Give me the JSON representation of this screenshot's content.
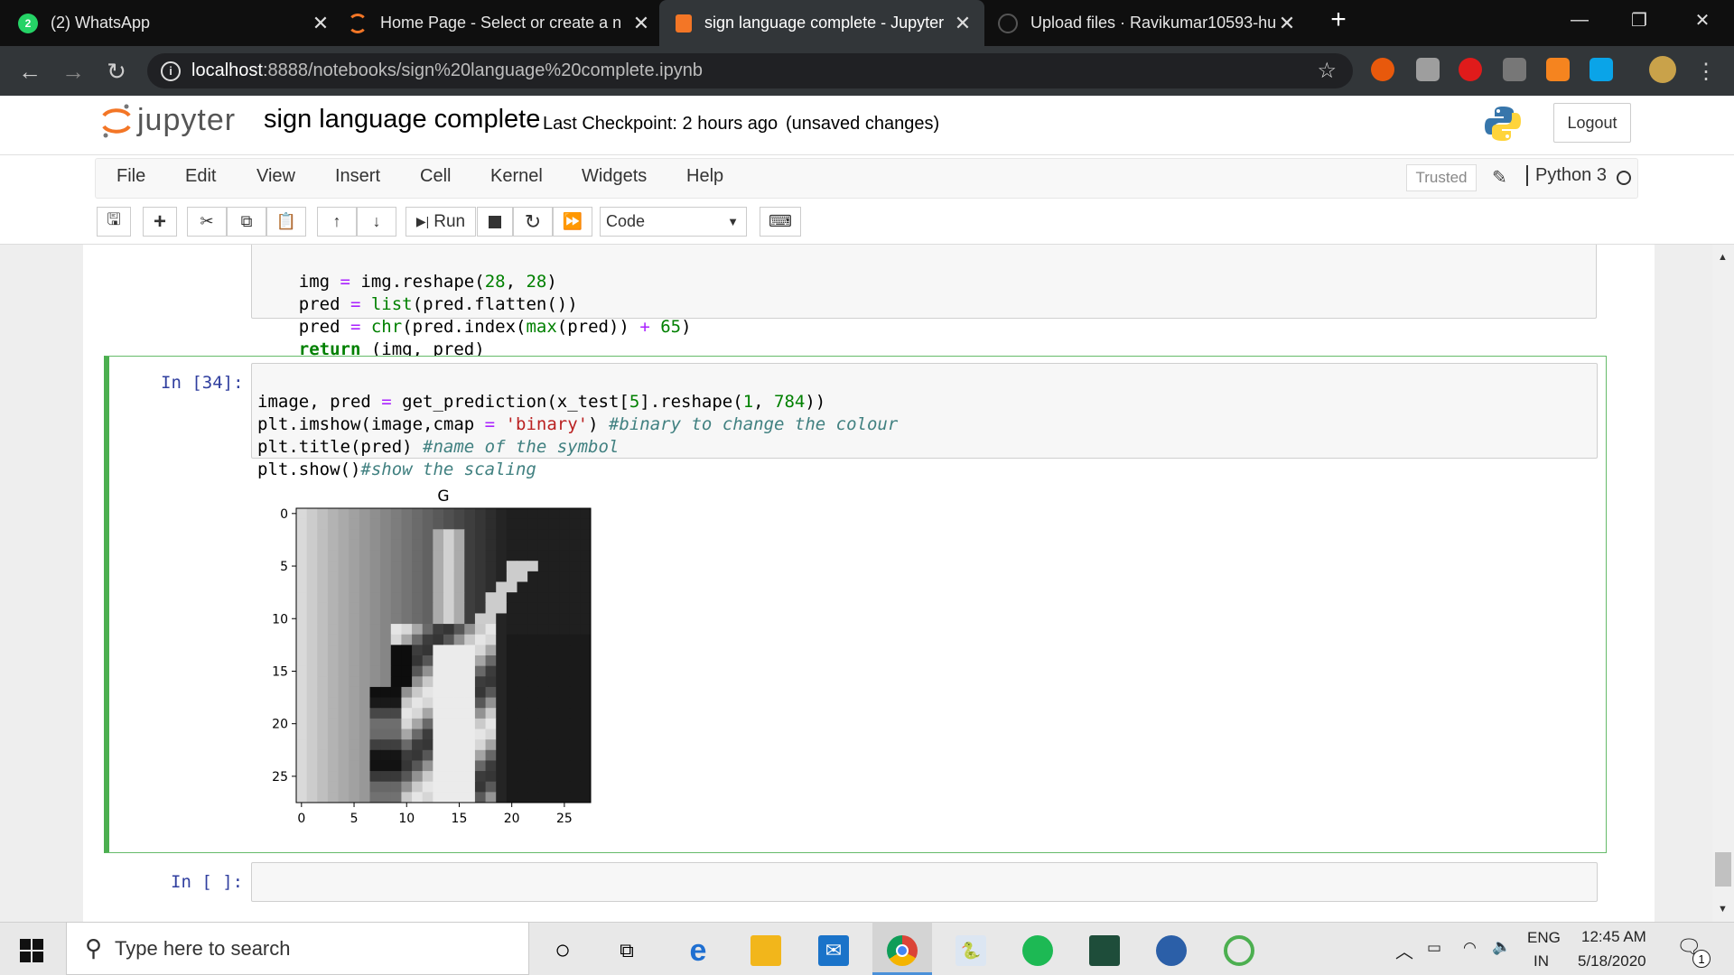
{
  "browser": {
    "tabs": [
      {
        "title": "(2) WhatsApp",
        "badge": "2"
      },
      {
        "title": "Home Page - Select or create a n"
      },
      {
        "title": "sign language complete - Jupyter"
      },
      {
        "title": "Upload files · Ravikumar10593-hu"
      }
    ],
    "url_host": "localhost",
    "url_rest": ":8888/notebooks/sign%20language%20complete.ipynb"
  },
  "jupyter": {
    "logo_text": "jupyter",
    "notebook_name": "sign language complete",
    "checkpoint": "Last Checkpoint: 2 hours ago",
    "unsaved": "(unsaved changes)",
    "logout": "Logout",
    "menu": [
      "File",
      "Edit",
      "View",
      "Insert",
      "Cell",
      "Kernel",
      "Widgets",
      "Help"
    ],
    "trusted": "Trusted",
    "kernel": "Python 3",
    "run_label": "Run",
    "cell_type": "Code"
  },
  "cells": {
    "prev_code": [
      "    img = img.reshape(28, 28)",
      "    pred = list(pred.flatten())",
      "    pred = chr(pred.index(max(pred)) + 65)",
      "    return (img, pred)"
    ],
    "active_prompt": "In [34]:",
    "active_code": [
      "image, pred = get_prediction(x_test[5].reshape(1, 784))",
      "plt.imshow(image,cmap = 'binary') #binary to change the colour",
      "plt.title(pred) #name of the symbol",
      "plt.show()#show the scaling"
    ],
    "empty_prompt": "In [ ]:"
  },
  "chart_data": {
    "type": "heatmap",
    "title": "G",
    "x_ticks": [
      "0",
      "5",
      "10",
      "15",
      "20",
      "25"
    ],
    "y_ticks": [
      "0",
      "5",
      "10",
      "15",
      "20",
      "25"
    ],
    "xlim": [
      0,
      27
    ],
    "ylim": [
      27,
      0
    ],
    "cmap": "binary",
    "grid": false
  },
  "taskbar": {
    "search_placeholder": "Type here to search",
    "lang_top": "ENG",
    "lang_bottom": "IN",
    "time": "12:45 AM",
    "date": "5/18/2020",
    "notif_count": "1"
  }
}
